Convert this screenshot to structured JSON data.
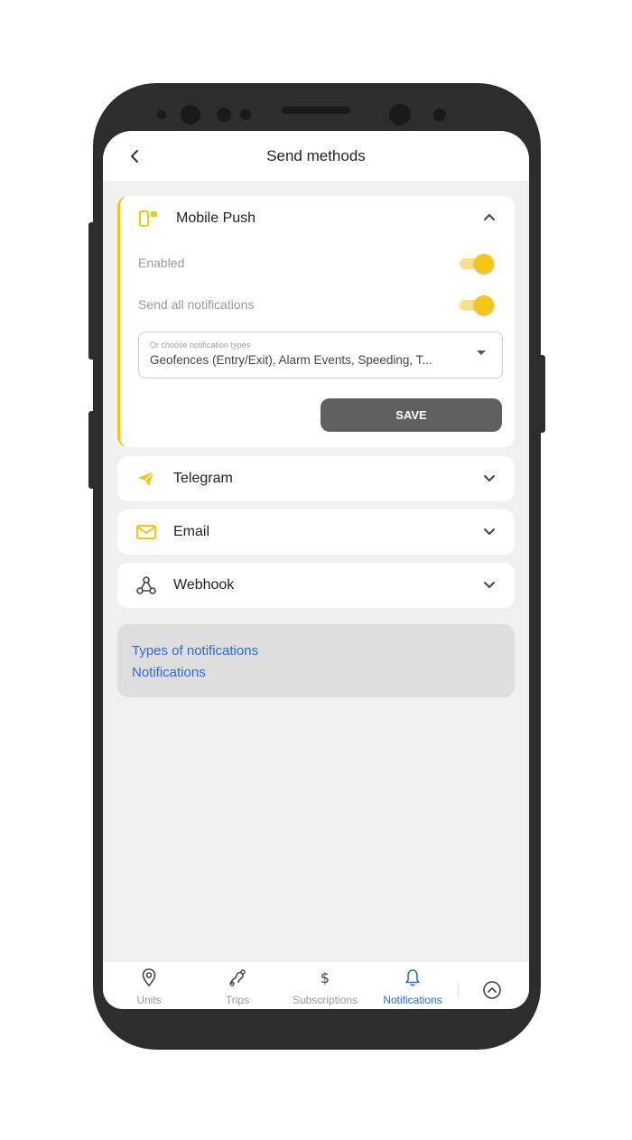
{
  "header": {
    "title": "Send methods",
    "back_icon": "chevron-left-icon"
  },
  "colors": {
    "accent": "#f5c518",
    "link": "#2d6ad8",
    "save_button": "#5f5f5f"
  },
  "methods": [
    {
      "label": "Mobile Push",
      "icon": "mobile-push-icon",
      "expanded": true,
      "settings": {
        "enabled_label": "Enabled",
        "enabled": true,
        "send_all_label": "Send all notifications",
        "send_all": true,
        "select_placeholder": "Or choose notification types",
        "select_value": "Geofences (Entry/Exit), Alarm Events, Speeding, T...",
        "save_label": "SAVE"
      }
    },
    {
      "label": "Telegram",
      "icon": "telegram-icon",
      "expanded": false
    },
    {
      "label": "Email",
      "icon": "email-icon",
      "expanded": false
    },
    {
      "label": "Webhook",
      "icon": "webhook-icon",
      "expanded": false
    }
  ],
  "links": [
    "Types of notifications",
    "Notifications"
  ],
  "bottom_nav": {
    "items": [
      {
        "label": "Units",
        "icon": "location-pin-icon",
        "active": false
      },
      {
        "label": "Trips",
        "icon": "trips-icon",
        "active": false
      },
      {
        "label": "Subscriptions",
        "icon": "dollar-icon",
        "active": false
      },
      {
        "label": "Notifications",
        "icon": "bell-icon",
        "active": true
      }
    ],
    "more_icon": "chevron-up-circle-icon"
  }
}
